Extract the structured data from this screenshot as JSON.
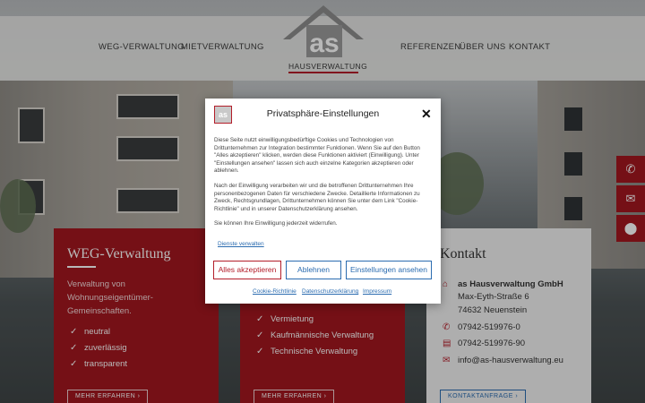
{
  "header": {
    "nav_left": [
      "WEG-VERWALTUNG",
      "MIETVERWALTUNG"
    ],
    "nav_right": [
      "REFERENZEN",
      "ÜBER UNS",
      "KONTAKT"
    ],
    "logo_text": "as",
    "logo_subtitle": "HAUSVERWALTUNG"
  },
  "cards": {
    "weg": {
      "title": "WEG-Verwaltung",
      "text": "Verwaltung von Wohnungseigentümer-Gemeinschaften.",
      "checks": [
        "neutral",
        "zuverlässig",
        "transparent"
      ],
      "button": "MEHR ERFAHREN"
    },
    "miet": {
      "checks": [
        "Vermietung",
        "Kaufmännische Verwaltung",
        "Technische Verwaltung"
      ],
      "button": "MEHR ERFAHREN"
    },
    "kontakt": {
      "title": "Kontakt",
      "company": "as Hausverwaltung GmbH",
      "street": "Max-Eyth-Straße 6",
      "city": "74632 Neuenstein",
      "phone": "07942-519976-0",
      "fax": "07942-519976-90",
      "email": "info@as-hausverwaltung.eu",
      "button": "KONTAKTANFRAGE"
    }
  },
  "side_buttons": [
    "phone-icon",
    "envelope-icon",
    "map-marker-icon"
  ],
  "consent": {
    "logo_text": "as",
    "title": "Privatsphäre-Einstellungen",
    "close": "✕",
    "paragraph1": "Diese Seite nutzt einwilligungsbedürftige Cookies und Technologien von Drittunternehmen zur Integration bestimmter Funktionen. Wenn Sie auf den Button \"Alles akzeptieren\" klicken, werden diese Funktionen aktiviert (Einwilligung). Unter \"Einstellungen ansehen\" lassen sich auch einzelne Kategorien akzeptieren oder ablehnen.",
    "paragraph2": "Nach der Einwilligung verarbeiten wir und die betroffenen Drittunternehmen Ihre personenbezogenen Daten für verschiedene Zwecke. Detaillierte Informationen zu Zweck, Rechtsgrundlagen, Drittunternehmen können Sie unter dem Link \"Cookie-Richtlinie\" und in unserer Datenschutzerklärung ansehen.",
    "paragraph3": "Sie können Ihre Einwilligung jederzeit widerrufen.",
    "services_link": "Dienste verwalten",
    "accept": "Alles akzeptieren",
    "deny": "Ablehnen",
    "settings": "Einstellungen ansehen",
    "footer_links": [
      "Cookie-Richtlinie",
      "Datenschutzerklärung",
      "Impressum"
    ]
  },
  "colors": {
    "brand_red": "#a3171f",
    "link_blue": "#2b6cb0"
  }
}
